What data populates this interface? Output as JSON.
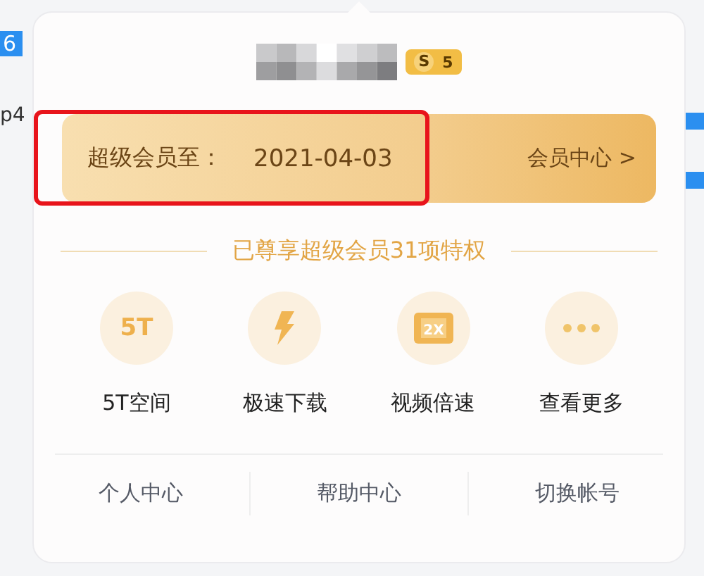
{
  "background": {
    "badge": "6",
    "row_text": "p4"
  },
  "popup": {
    "level_badge": {
      "letter": "S",
      "number": "5"
    },
    "membership": {
      "label": "超级会员至：",
      "date": "2021-04-03",
      "link": "会员中心 >"
    },
    "privileges_title": "已尊享超级会员31项特权",
    "privileges": [
      {
        "kind": "storage",
        "icon_text": "5T",
        "label": "5T空间"
      },
      {
        "kind": "speed",
        "label": "极速下载"
      },
      {
        "kind": "video",
        "icon_text": "2X",
        "label": "视频倍速"
      },
      {
        "kind": "more",
        "label": "查看更多"
      }
    ],
    "footer_links": [
      "个人中心",
      "帮助中心",
      "切换帐号"
    ]
  }
}
